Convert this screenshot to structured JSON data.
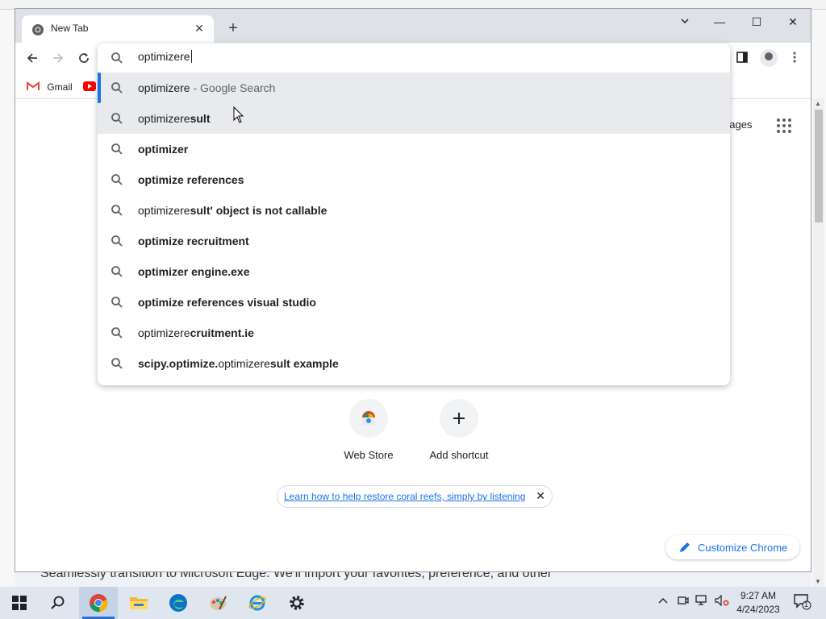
{
  "browser": {
    "tab_title": "New Tab",
    "new_tab_symbol": "+",
    "window_controls": {
      "minimize": "—",
      "maximize": "☐",
      "close": "✕"
    }
  },
  "bookmarks": [
    {
      "label": "Gmail",
      "icon": "gmail-icon"
    },
    {
      "label": "",
      "icon": "youtube-icon"
    }
  ],
  "omnibox": {
    "value": "optimizere",
    "suggestions": [
      {
        "pre": "optimizere",
        "bold": "",
        "rest_pre": "",
        "rest_bold": "",
        "suffix": " - Google Search",
        "state": "selected"
      },
      {
        "pre": "optimizere",
        "bold": "sult",
        "rest_pre": "",
        "rest_bold": "",
        "suffix": "",
        "state": "hover"
      },
      {
        "pre": "",
        "bold": "optimizer",
        "rest_pre": "",
        "rest_bold": "",
        "suffix": "",
        "state": ""
      },
      {
        "pre": "",
        "bold": "optimize references",
        "rest_pre": "",
        "rest_bold": "",
        "suffix": "",
        "state": ""
      },
      {
        "pre": "optimizere",
        "bold": "sult' object is not callable",
        "rest_pre": "",
        "rest_bold": "",
        "suffix": "",
        "state": ""
      },
      {
        "pre": "",
        "bold": "optimize recruitment",
        "rest_pre": "",
        "rest_bold": "",
        "suffix": "",
        "state": ""
      },
      {
        "pre": "",
        "bold": "optimizer engine.exe",
        "rest_pre": "",
        "rest_bold": "",
        "suffix": "",
        "state": ""
      },
      {
        "pre": "",
        "bold": "optimize references visual studio",
        "rest_pre": "",
        "rest_bold": "",
        "suffix": "",
        "state": ""
      },
      {
        "pre": "optimizere",
        "bold": "cruitment.ie",
        "rest_pre": "",
        "rest_bold": "",
        "suffix": "",
        "state": ""
      },
      {
        "pre": "",
        "bold": "scipy.optimize.",
        "rest_pre": "optimizere",
        "rest_bold": "sult example",
        "suffix": "",
        "state": ""
      }
    ]
  },
  "ntp": {
    "images_link": "nages",
    "shortcuts": [
      {
        "label": "Web Store",
        "icon": "chrome-webstore-icon"
      },
      {
        "label": "Add shortcut",
        "icon": "plus-icon"
      }
    ],
    "promo_text": "Learn how to help restore coral reefs, simply by listening",
    "promo_close": "✕",
    "customize_label": "Customize Chrome"
  },
  "background_window": {
    "text": "Seamlessly transition to Microsoft Edge. We'll import your favorites, preference, and other"
  },
  "taskbar": {
    "apps": [
      "windows-start-icon",
      "search-icon",
      "chrome-icon",
      "file-explorer-icon",
      "edge-icon",
      "paint-icon",
      "internet-explorer-icon",
      "settings-icon"
    ],
    "time": "9:27 AM",
    "date": "4/24/2023",
    "notification_count": "1"
  },
  "colors": {
    "accent": "#1a73e8",
    "titlebar": "#dee1e6",
    "taskbar": "#dfe6f0",
    "suggestion_hover": "#e8eaed"
  }
}
